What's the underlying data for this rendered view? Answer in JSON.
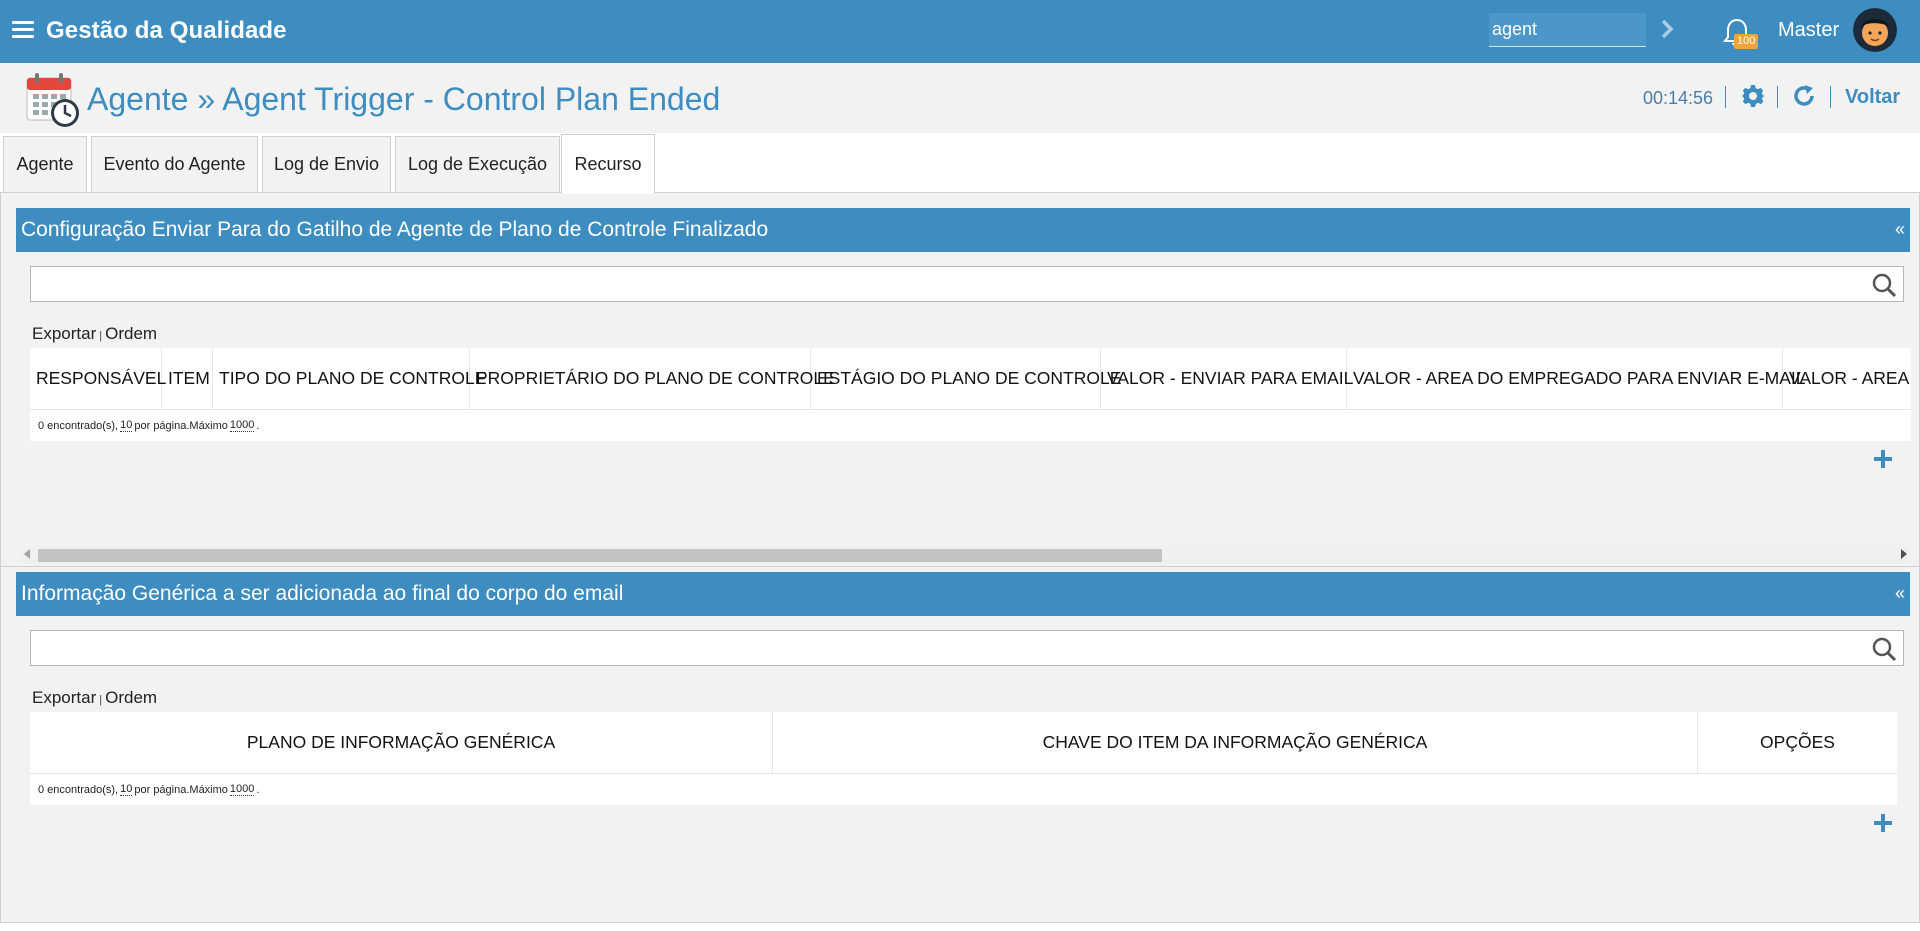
{
  "app": {
    "title": "Gestão da Qualidade",
    "search_value": "agent",
    "notification_count": "100",
    "user_name": "Master"
  },
  "header": {
    "title": "Agente » Agent Trigger - Control Plan Ended",
    "timer": "00:14:56",
    "back_label": "Voltar"
  },
  "tabs": [
    {
      "label": "Agente",
      "active": false
    },
    {
      "label": "Evento do Agente",
      "active": false
    },
    {
      "label": "Log de Envio",
      "active": false
    },
    {
      "label": "Log de Execução",
      "active": false
    },
    {
      "label": "Recurso",
      "active": true
    }
  ],
  "panel1": {
    "title": "Configuração Enviar Para do Gatilho de Agente de Plano de Controle Finalizado",
    "collapse": "«",
    "search_value": "",
    "export_label": "Exportar",
    "order_label": "Ordem",
    "columns": [
      "RESPONSÁVEL",
      "ITEM",
      "TIPO DO PLANO DE CONTROLE",
      "PROPRIETÁRIO DO PLANO DE CONTROLE",
      "ESTÁGIO DO PLANO DE CONTROLE",
      "VALOR - ENVIAR PARA EMAIL",
      "VALOR - AREA DO EMPREGADO PARA ENVIAR E-MAIL",
      "VALOR - AREA D"
    ],
    "footer": {
      "prefix": "0 encontrado(s),",
      "per_page": "10",
      "middle": "por página.Máximo",
      "max": "1000",
      "suffix": "."
    }
  },
  "panel2": {
    "title": "Informação Genérica a ser adicionada ao final do corpo do email",
    "collapse": "«",
    "search_value": "",
    "export_label": "Exportar",
    "order_label": "Ordem",
    "columns": [
      "PLANO DE INFORMAÇÃO GENÉRICA",
      "CHAVE DO ITEM DA INFORMAÇÃO GENÉRICA",
      "OPÇÕES"
    ],
    "footer": {
      "prefix": "0 encontrado(s),",
      "per_page": "10",
      "middle": "por página.Máximo",
      "max": "1000",
      "suffix": "."
    }
  },
  "colors": {
    "brand": "#3d8dc0",
    "badge": "#f2a33a",
    "background": "#f2f2f2"
  },
  "icons": [
    "menu-icon",
    "chevron-right-icon",
    "bell-icon",
    "avatar",
    "calendar-clock-icon",
    "gear-icon",
    "refresh-icon",
    "search-icon",
    "plus-icon"
  ]
}
